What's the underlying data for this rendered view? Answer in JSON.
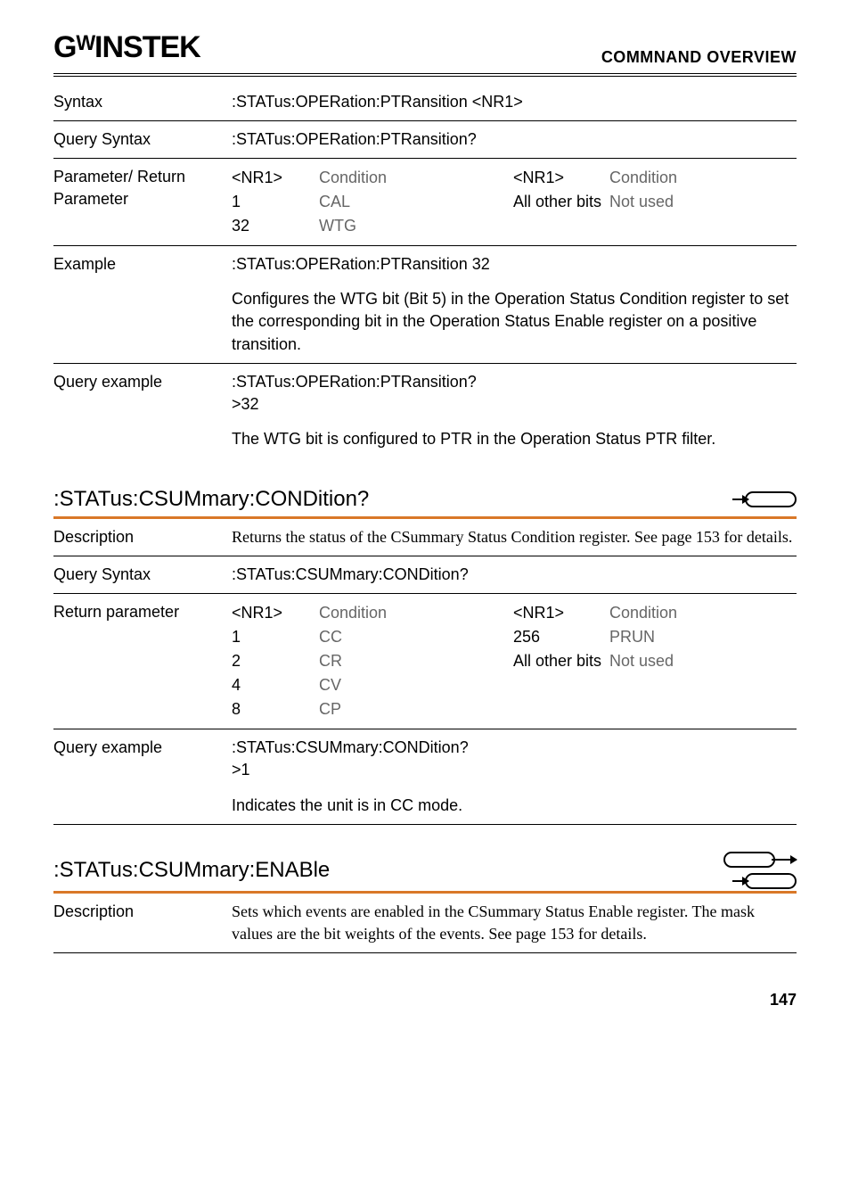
{
  "header": {
    "logo": "GᵂINSTEK",
    "title": "COMMNAND OVERVIEW"
  },
  "sec1": {
    "syntax_label": "Syntax",
    "syntax_value": ":STATus:OPERation:PTRansition <NR1>",
    "query_syntax_label": "Query Syntax",
    "query_syntax_value": ":STATus:OPERation:PTRansition?",
    "param_label": "Parameter/ Return Parameter",
    "p_hdr1": "<NR1>",
    "p_hdr2": "Condition",
    "p_hdr3": "<NR1>",
    "p_hdr4": "Condition",
    "p_r1c1": "1",
    "p_r1c2": "CAL",
    "p_r1c3": "All other bits",
    "p_r1c4": "Not used",
    "p_r2c1": "32",
    "p_r2c2": "WTG",
    "example_label": "Example",
    "example_line1": ":STATus:OPERation:PTRansition 32",
    "example_para": "Configures the WTG bit (Bit 5) in the Operation Status Condition register to set the corresponding bit in the Operation Status Enable register on a positive transition.",
    "query_ex_label": "Query example",
    "query_ex_line1": ":STATus:OPERation:PTRansition?",
    "query_ex_line2": ">32",
    "query_ex_para": "The WTG bit is configured to PTR in the Operation Status PTR filter."
  },
  "sec2": {
    "heading": ":STATus:CSUMmary:CONDition?",
    "desc_label": "Description",
    "desc_value": "Returns the status of the CSummary Status Condition register. See page 153 for details.",
    "query_syntax_label": "Query Syntax",
    "query_syntax_value": ":STATus:CSUMmary:CONDition?",
    "ret_label": "Return parameter",
    "p_hdr1": "<NR1>",
    "p_hdr2": "Condition",
    "p_hdr3": "<NR1>",
    "p_hdr4": "Condition",
    "r1c1": "1",
    "r1c2": "CC",
    "r1c3": "256",
    "r1c4": "PRUN",
    "r2c1": "2",
    "r2c2": "CR",
    "r2c3": "All other bits",
    "r2c4": "Not used",
    "r3c1": "4",
    "r3c2": "CV",
    "r4c1": "8",
    "r4c2": "CP",
    "query_ex_label": "Query example",
    "query_ex_line1": ":STATus:CSUMmary:CONDition?",
    "query_ex_line2": ">1",
    "query_ex_para": "Indicates the unit is in CC mode."
  },
  "sec3": {
    "heading": ":STATus:CSUMmary:ENABle",
    "desc_label": "Description",
    "desc_value": "Sets which events are enabled in the CSummary Status Enable register. The mask values are the bit weights of the events. See page 153 for details."
  },
  "page": "147"
}
